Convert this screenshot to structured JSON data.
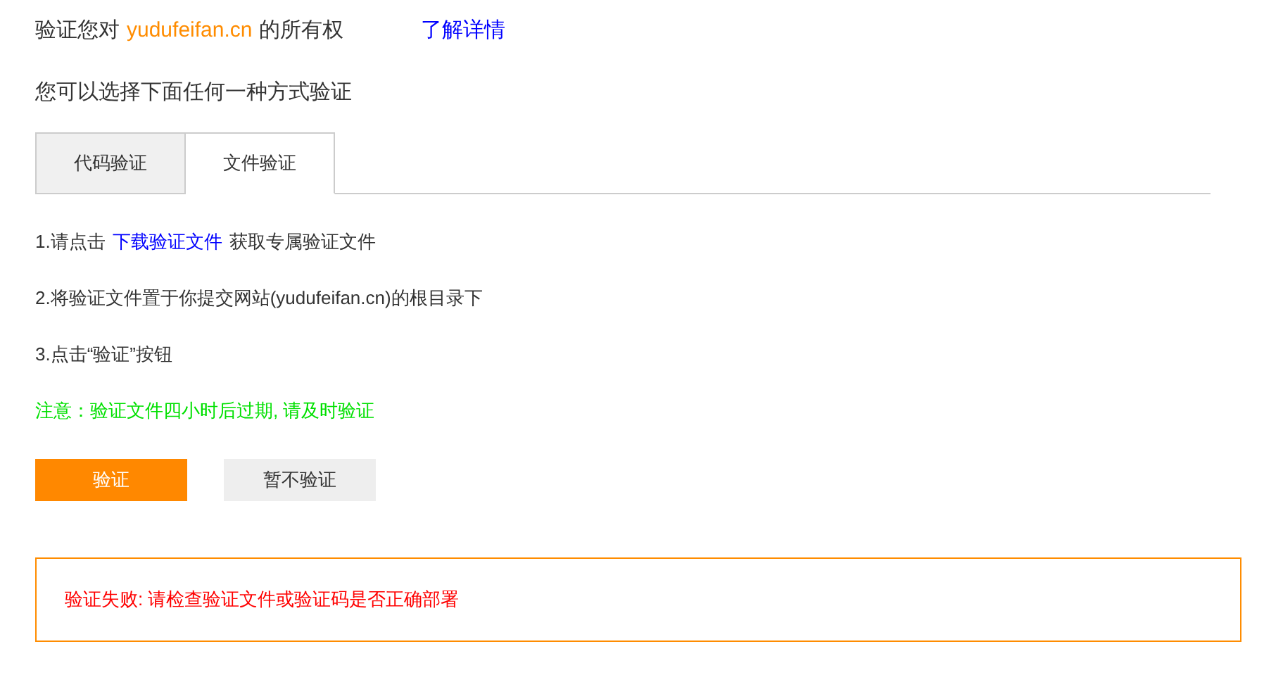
{
  "heading": {
    "parts": [
      {
        "kind": "text",
        "text": "验证您对"
      },
      {
        "kind": "domain",
        "text": "yudufeifan.cn"
      },
      {
        "kind": "text",
        "text": "的所有权"
      }
    ],
    "link": "了解详情"
  },
  "intro": "您可以选择下面任何一种方式验证",
  "tabs": [
    {
      "label": "代码验证",
      "selected": false
    },
    {
      "label": "文件验证",
      "selected": true
    }
  ],
  "steps": [
    {
      "parts": [
        {
          "kind": "text",
          "text": "1.请点击"
        },
        {
          "kind": "link",
          "text": "下载验证文件"
        },
        {
          "kind": "text",
          "text": "获取专属验证文件"
        }
      ]
    },
    {
      "parts": [
        {
          "kind": "text",
          "text": "2.将验证文件置于你提交网站(yudufeifan.cn)的根目录下"
        }
      ]
    },
    {
      "parts": [
        {
          "kind": "text",
          "text": "3.点击“验证”按钮"
        }
      ]
    }
  ],
  "notice": "注意：验证文件四小时后过期, 请及时验证",
  "buttons": [
    {
      "label": "验证",
      "kind": "primary"
    },
    {
      "label": "暂不验证",
      "kind": "secondary"
    }
  ],
  "error": "验证失败: 请检查验证文件或验证码是否正确部署"
}
